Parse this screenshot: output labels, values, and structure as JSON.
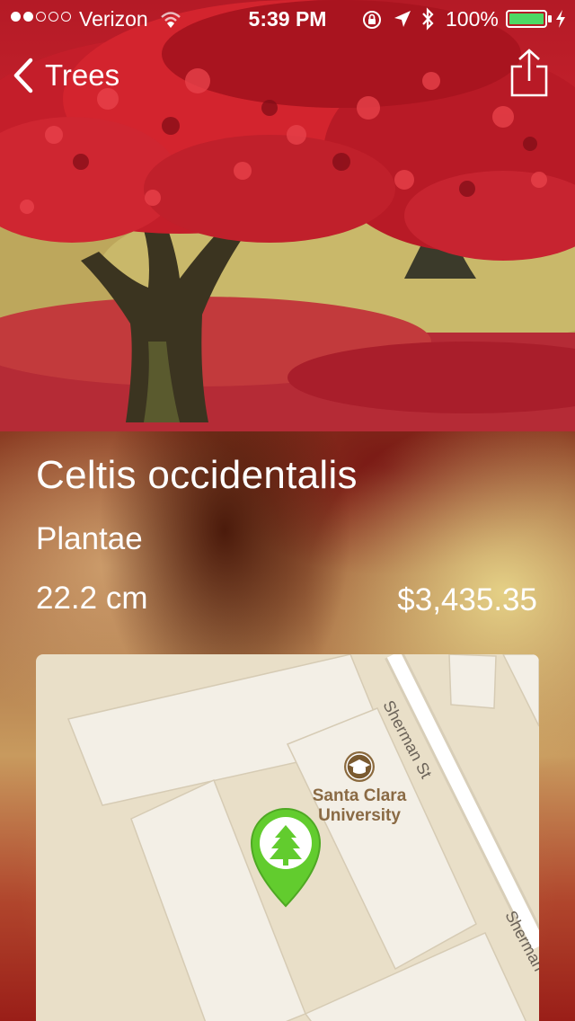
{
  "status_bar": {
    "carrier": "Verizon",
    "time": "5:39 PM",
    "battery_percent": "100%",
    "signal_bars_filled": 2,
    "signal_bars_total": 5
  },
  "nav": {
    "back_label": "Trees",
    "back_icon": "chevron-left-icon",
    "share_icon": "share-icon"
  },
  "tree": {
    "name": "Celtis occidentalis",
    "kingdom": "Plantae",
    "diameter": "22.2 cm",
    "value": "$3,435.35"
  },
  "map": {
    "poi_label_line1": "Santa Clara",
    "poi_label_line2": "University",
    "poi_icon": "graduation-cap-icon",
    "street_1": "Sherman St",
    "street_2": "Sherman",
    "marker_icon": "tree-pin-icon"
  },
  "colors": {
    "marker_green": "#62cc2e",
    "battery_green": "#4cd964"
  }
}
